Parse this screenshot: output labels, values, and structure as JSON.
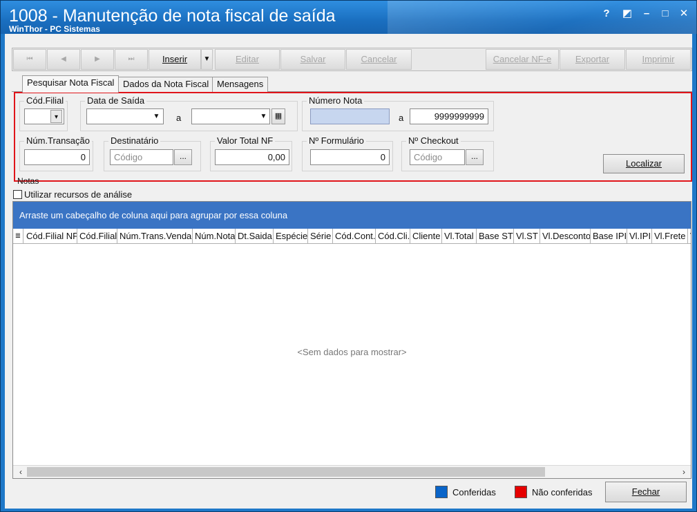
{
  "window": {
    "title": "1008 - Manutenção de nota fiscal de saída",
    "subtitle": "WinThor - PC Sistemas",
    "controls": {
      "help": "?",
      "restore_small": "◩",
      "minimize": "–",
      "maximize": "□",
      "close": "✕"
    }
  },
  "toolbar": {
    "first": "⏮",
    "prev": "◀",
    "next": "▶",
    "last": "⏭",
    "inserir": "Inserir",
    "dropdown": "▼",
    "editar": "Editar",
    "salvar": "Salvar",
    "cancelar": "Cancelar",
    "cancelar_nfe": "Cancelar NF-e",
    "exportar": "Exportar",
    "imprimir": "Imprimir"
  },
  "tabs": [
    "Pesquisar Nota Fiscal",
    "Dados da Nota Fiscal",
    "Mensagens"
  ],
  "filters": {
    "cod_filial": {
      "label": "Cód.Filial",
      "value": ""
    },
    "data_saida": {
      "label": "Data de Saída",
      "from": "",
      "to": "",
      "separator": "a"
    },
    "numero_nota": {
      "label": "Número Nota",
      "from": "",
      "to": "9999999999",
      "separator": "a"
    },
    "num_transacao": {
      "label": "Núm.Transação",
      "value": "0"
    },
    "destinatario": {
      "label": "Destinatário",
      "placeholder": "Código",
      "button": "..."
    },
    "valor_total_nf": {
      "label": "Valor Total NF",
      "value": "0,00"
    },
    "n_formulario": {
      "label": "Nº Formulário",
      "value": "0"
    },
    "n_checkout": {
      "label": "Nº Checkout",
      "placeholder": "Código",
      "button": "..."
    },
    "localizar": "Localizar"
  },
  "notas": {
    "label": "Notas",
    "analysis_checkbox": "Utilizar recursos de análise",
    "analysis_checked": false
  },
  "grid": {
    "group_hint": "Arraste um cabeçalho de coluna aqui para agrupar por essa coluna",
    "columns": [
      "Cód.Filial NF",
      "Cód.Filial",
      "Núm.Trans.Venda",
      "Núm.Nota",
      "Dt.Saida",
      "Espécie",
      "Série",
      "Cód.Cont.",
      "Cód.Cli.",
      "Cliente",
      "Vl.Total",
      "Base ST",
      "Vl.ST",
      "Vl.Desconto",
      "Base IPI",
      "Vl.IPI",
      "Vl.Frete",
      "V"
    ],
    "empty_text": "<Sem dados para mostrar>"
  },
  "footer": {
    "legend": [
      {
        "label": "Conferidas",
        "color": "#0a64c8"
      },
      {
        "label": "Não conferidas",
        "color": "#e60000"
      }
    ],
    "fechar": "Fechar"
  }
}
